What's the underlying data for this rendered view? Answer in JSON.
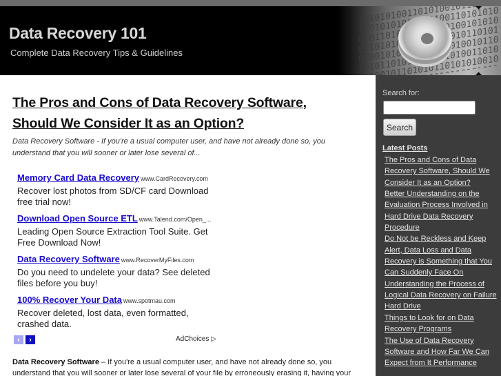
{
  "header": {
    "site_title": "Data Recovery 101",
    "tagline": "Complete Data Recovery Tips & Guidelines",
    "art_bits": "10101010011010100101101010110101010010101001101010100101101010110101010010101001101010100101101010110101010010101001101010100101101010110101010010101001101010100101101010110101010010101001101010100101101010110101"
  },
  "post": {
    "title": "The Pros and Cons of Data Recovery Software, Should We Consider It as an Option?",
    "excerpt": "Data Recovery Software - If you're a usual computer user, and have not already done so, you understand that you will sooner or later lose several of...",
    "body_lead": "Data Recovery Software",
    "body_text": " – If you're a usual computer user, and have not already done so, you understand that you will sooner or later lose several of your file by erroneously erasing it, having your"
  },
  "ads": {
    "items": [
      {
        "title": "Memory Card Data Recovery",
        "url": "www.CardRecovery.com",
        "desc": "Recover lost photos from SD/CF card Download free trial now!"
      },
      {
        "title": "Download Open Source ETL",
        "url": "www.Talend.com/Open_...",
        "desc": "Leading Open Source Extraction Tool Suite. Get Free Download Now!"
      },
      {
        "title": "Data Recovery Software",
        "url": "www.RecoverMyFiles.com",
        "desc": "Do you need to undelete your data? See deleted files before you buy!"
      },
      {
        "title": "100% Recover Your Data",
        "url": "www.spotmau.com",
        "desc": "Recover deleted, lost data, even formatted, crashed data."
      }
    ],
    "prev_icon": "‹",
    "next_icon": "›",
    "adchoices_label": "AdChoices ▷"
  },
  "sidebar": {
    "search_label": "Search for:",
    "search_value": "",
    "search_button": "Search",
    "latest_heading": "Latest Posts",
    "latest_posts": [
      "The Pros and Cons of Data Recovery Software, Should We Consider It as an Option?",
      "Better Understanding on the Evaluation Process Involved in Hard Drive Data Recovery Procedure",
      "Do Not be Reckless and Keep Alert, Data Loss and Data Recovery is Something that You Can Suddenly Face On",
      "Understanding the Process of Logical Data Recovery on Failure Hard Drive",
      "Things to Look for on Data Recovery Programs",
      "The Use of Data Recovery Software and How Far We Can Expect from It Performance"
    ]
  },
  "colors": {
    "ad_link": "#1a0dcc",
    "sidebar_bg": "#3c3c3c",
    "header_bg": "#000000"
  }
}
